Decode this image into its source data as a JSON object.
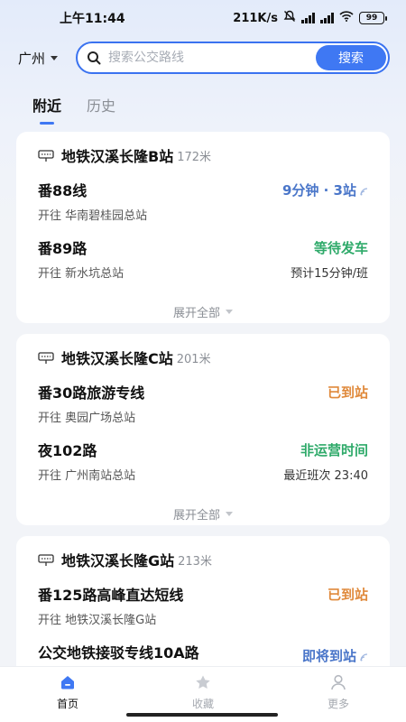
{
  "status_bar": {
    "time": "上午11:44",
    "speed": "211K/s",
    "battery": "99"
  },
  "header": {
    "city": "广州",
    "search_placeholder": "搜索公交路线",
    "search_button": "搜索"
  },
  "tabs": [
    {
      "label": "附近",
      "active": true
    },
    {
      "label": "历史",
      "active": false
    }
  ],
  "stations": [
    {
      "name": "地铁汉溪长隆B站",
      "distance": "172米",
      "routes": [
        {
          "name": "番88线",
          "destination": "开往 华南碧桂园总站",
          "status": "9分钟 · 3站",
          "status_color": "blue",
          "sub": ""
        },
        {
          "name": "番89路",
          "destination": "开往 新水坑总站",
          "status": "等待发车",
          "status_color": "green",
          "sub": "预计15分钟/班"
        }
      ],
      "expand_label": "展开全部"
    },
    {
      "name": "地铁汉溪长隆C站",
      "distance": "201米",
      "routes": [
        {
          "name": "番30路旅游专线",
          "destination": "开往 奥园广场总站",
          "status": "已到站",
          "status_color": "orange",
          "sub": ""
        },
        {
          "name": "夜102路",
          "destination": "开往 广州南站总站",
          "status": "非运营时间",
          "status_color": "green",
          "sub": "最近班次 23:40"
        }
      ],
      "expand_label": "展开全部"
    },
    {
      "name": "地铁汉溪长隆G站",
      "distance": "213米",
      "routes": [
        {
          "name": "番125路高峰直达短线",
          "destination": "开往 地铁汉溪长隆G站",
          "status": "已到站",
          "status_color": "orange",
          "sub": ""
        },
        {
          "name": "公交地铁接驳专线10A路",
          "destination": "",
          "status": "即将到站",
          "status_color": "blue",
          "sub": ""
        }
      ]
    }
  ],
  "bottom_nav": [
    {
      "label": "首页",
      "icon": "home-icon",
      "active": true
    },
    {
      "label": "收藏",
      "icon": "favorite-icon",
      "active": false
    },
    {
      "label": "更多",
      "icon": "user-icon",
      "active": false
    }
  ],
  "colors": {
    "accent": "#3f78f3",
    "status_blue": "#4a76c9",
    "status_green": "#2faa6a",
    "status_orange": "#e08a3c"
  }
}
